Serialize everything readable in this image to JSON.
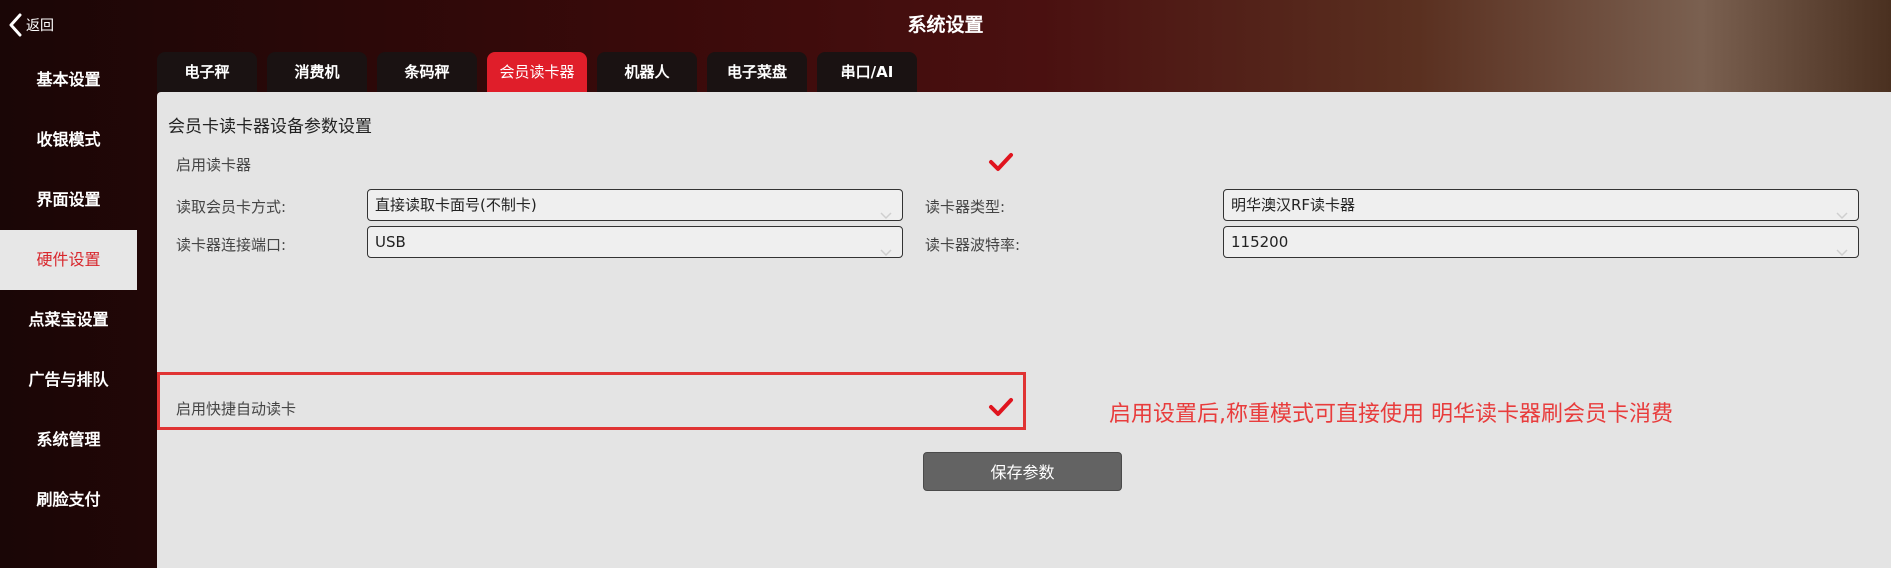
{
  "header": {
    "back_label": "返回",
    "title": "系统设置"
  },
  "sidebar": {
    "items": [
      {
        "label": "基本设置"
      },
      {
        "label": "收银模式"
      },
      {
        "label": "界面设置"
      },
      {
        "label": "硬件设置"
      },
      {
        "label": "点菜宝设置"
      },
      {
        "label": "广告与排队"
      },
      {
        "label": "系统管理"
      },
      {
        "label": "刷脸支付"
      }
    ],
    "active_index": 3
  },
  "tabs": {
    "items": [
      {
        "label": "电子秤"
      },
      {
        "label": "消费机"
      },
      {
        "label": "条码秤"
      },
      {
        "label": "会员读卡器"
      },
      {
        "label": "机器人"
      },
      {
        "label": "电子菜盘"
      },
      {
        "label": "串口/AI"
      }
    ],
    "active_index": 3
  },
  "panel": {
    "section_title": "会员卡读卡器设备参数设置",
    "enable_reader": {
      "label": "启用读卡器",
      "checked": true
    },
    "read_method": {
      "label": "读取会员卡方式:",
      "value": "直接读取卡面号(不制卡)"
    },
    "reader_type": {
      "label": "读卡器类型:",
      "value": "明华澳汉RF读卡器"
    },
    "reader_port": {
      "label": "读卡器连接端口:",
      "value": "USB"
    },
    "baud_rate": {
      "label": "读卡器波特率:",
      "value": "115200"
    },
    "quick_read": {
      "label": "启用快捷自动读卡",
      "checked": true
    },
    "note": "启用设置后,称重模式可直接使用 明华读卡器刷会员卡消费",
    "save_label": "保存参数"
  },
  "colors": {
    "accent": "#e01e2a",
    "check": "#e0141e",
    "note": "#e83c3c"
  }
}
